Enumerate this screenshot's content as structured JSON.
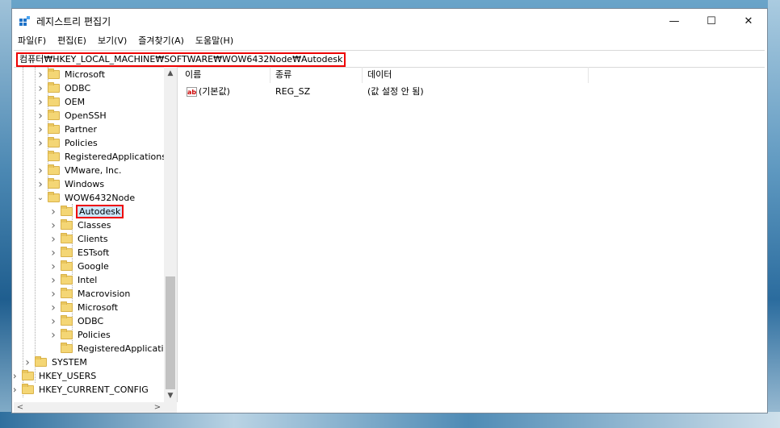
{
  "window": {
    "title": "레지스트리 편집기",
    "controls": {
      "minimize": "—",
      "maximize": "☐",
      "close": "✕"
    }
  },
  "menu": [
    "파일(F)",
    "편집(E)",
    "보기(V)",
    "즐겨찾기(A)",
    "도움말(H)"
  ],
  "address": "컴퓨터₩HKEY_LOCAL_MACHINE₩SOFTWARE₩WOW6432Node₩Autodesk",
  "tree": {
    "items": [
      {
        "label": "Microsoft",
        "level": 2,
        "expander": "collapsed"
      },
      {
        "label": "ODBC",
        "level": 2,
        "expander": "collapsed"
      },
      {
        "label": "OEM",
        "level": 2,
        "expander": "collapsed"
      },
      {
        "label": "OpenSSH",
        "level": 2,
        "expander": "collapsed"
      },
      {
        "label": "Partner",
        "level": 2,
        "expander": "collapsed"
      },
      {
        "label": "Policies",
        "level": 2,
        "expander": "collapsed"
      },
      {
        "label": "RegisteredApplications",
        "level": 2,
        "expander": "none"
      },
      {
        "label": "VMware, Inc.",
        "level": 2,
        "expander": "collapsed"
      },
      {
        "label": "Windows",
        "level": 2,
        "expander": "collapsed"
      },
      {
        "label": "WOW6432Node",
        "level": 2,
        "expander": "expanded"
      },
      {
        "label": "Autodesk",
        "level": 3,
        "expander": "collapsed",
        "selected": true
      },
      {
        "label": "Classes",
        "level": 3,
        "expander": "collapsed"
      },
      {
        "label": "Clients",
        "level": 3,
        "expander": "collapsed"
      },
      {
        "label": "ESTsoft",
        "level": 3,
        "expander": "collapsed"
      },
      {
        "label": "Google",
        "level": 3,
        "expander": "collapsed"
      },
      {
        "label": "Intel",
        "level": 3,
        "expander": "collapsed"
      },
      {
        "label": "Macrovision",
        "level": 3,
        "expander": "collapsed"
      },
      {
        "label": "Microsoft",
        "level": 3,
        "expander": "collapsed"
      },
      {
        "label": "ODBC",
        "level": 3,
        "expander": "collapsed"
      },
      {
        "label": "Policies",
        "level": 3,
        "expander": "collapsed"
      },
      {
        "label": "RegisteredApplications",
        "level": 3,
        "expander": "none"
      },
      {
        "label": "SYSTEM",
        "level": 1,
        "expander": "collapsed"
      },
      {
        "label": "HKEY_USERS",
        "level": 0,
        "expander": "collapsed"
      },
      {
        "label": "HKEY_CURRENT_CONFIG",
        "level": 0,
        "expander": "collapsed"
      }
    ]
  },
  "columns": [
    "이름",
    "종류",
    "데이터"
  ],
  "values": [
    {
      "name": "(기본값)",
      "type": "REG_SZ",
      "data": "(값 설정 안 됨)",
      "icon": "ab"
    }
  ],
  "colors": {
    "highlight": "#e00000",
    "folder": "#f4d675",
    "selection": "#cde8ff"
  }
}
